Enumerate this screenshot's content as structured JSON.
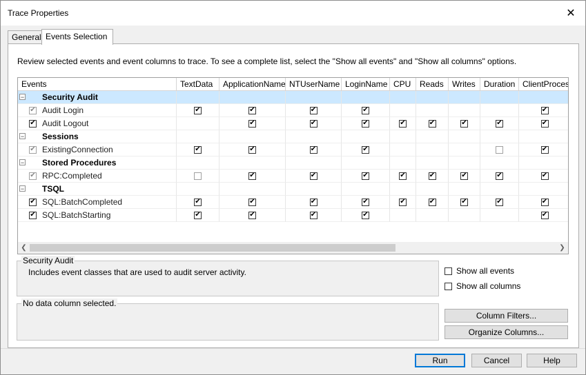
{
  "window": {
    "title": "Trace Properties"
  },
  "tabs": [
    {
      "label": "General",
      "active": false
    },
    {
      "label": "Events Selection",
      "active": true
    }
  ],
  "hint": "Review selected events and event columns to trace. To see a complete list, select the \"Show all events\" and \"Show all columns\" options.",
  "grid": {
    "columns": [
      "Events",
      "TextData",
      "ApplicationName",
      "NTUserName",
      "LoginName",
      "CPU",
      "Reads",
      "Writes",
      "Duration",
      "ClientProcessI"
    ],
    "rows": [
      {
        "type": "category",
        "label": "Security Audit",
        "collapse": "−",
        "selected": true
      },
      {
        "type": "event",
        "label": "Audit Login",
        "check": "gray",
        "cells": [
          "checked",
          "checked",
          "checked",
          "checked",
          "none",
          "none",
          "none",
          "none",
          "checked"
        ]
      },
      {
        "type": "event",
        "label": "Audit Logout",
        "check": "checked",
        "cells": [
          "none",
          "checked",
          "checked",
          "checked",
          "checked",
          "checked",
          "checked",
          "checked",
          "checked"
        ]
      },
      {
        "type": "category",
        "label": "Sessions",
        "collapse": "−"
      },
      {
        "type": "event",
        "label": "ExistingConnection",
        "check": "gray",
        "cells": [
          "checked",
          "checked",
          "checked",
          "checked",
          "none",
          "none",
          "none",
          "empty",
          "checked"
        ]
      },
      {
        "type": "category",
        "label": "Stored Procedures",
        "collapse": "−"
      },
      {
        "type": "event",
        "label": "RPC:Completed",
        "check": "gray",
        "cells": [
          "empty",
          "checked",
          "checked",
          "checked",
          "checked",
          "checked",
          "checked",
          "checked",
          "checked"
        ]
      },
      {
        "type": "category",
        "label": "TSQL",
        "collapse": "−"
      },
      {
        "type": "event",
        "label": "SQL:BatchCompleted",
        "check": "checked",
        "cells": [
          "checked",
          "checked",
          "checked",
          "checked",
          "checked",
          "checked",
          "checked",
          "checked",
          "checked"
        ]
      },
      {
        "type": "event",
        "label": "SQL:BatchStarting",
        "check": "checked",
        "cells": [
          "checked",
          "checked",
          "checked",
          "checked",
          "none",
          "none",
          "none",
          "none",
          "checked"
        ]
      }
    ]
  },
  "description_box": {
    "title": "Security Audit",
    "text": "Includes event classes that are used to audit server activity."
  },
  "column_box": {
    "title": "No data column selected."
  },
  "options": {
    "show_all_events": "Show all events",
    "show_all_columns": "Show all columns"
  },
  "buttons": {
    "column_filters": "Column Filters...",
    "organize_columns": "Organize Columns...",
    "run": "Run",
    "cancel": "Cancel",
    "help": "Help"
  },
  "icons": {
    "close": "close-icon",
    "scroll_left": "chevron-left-icon",
    "scroll_right": "chevron-right-icon",
    "check_glyph": "✔",
    "close_glyph": "✕",
    "left_glyph": "❮",
    "right_glyph": "❯"
  },
  "colors": {
    "selection": "#cce8ff",
    "default_button_border": "#0078d7"
  }
}
